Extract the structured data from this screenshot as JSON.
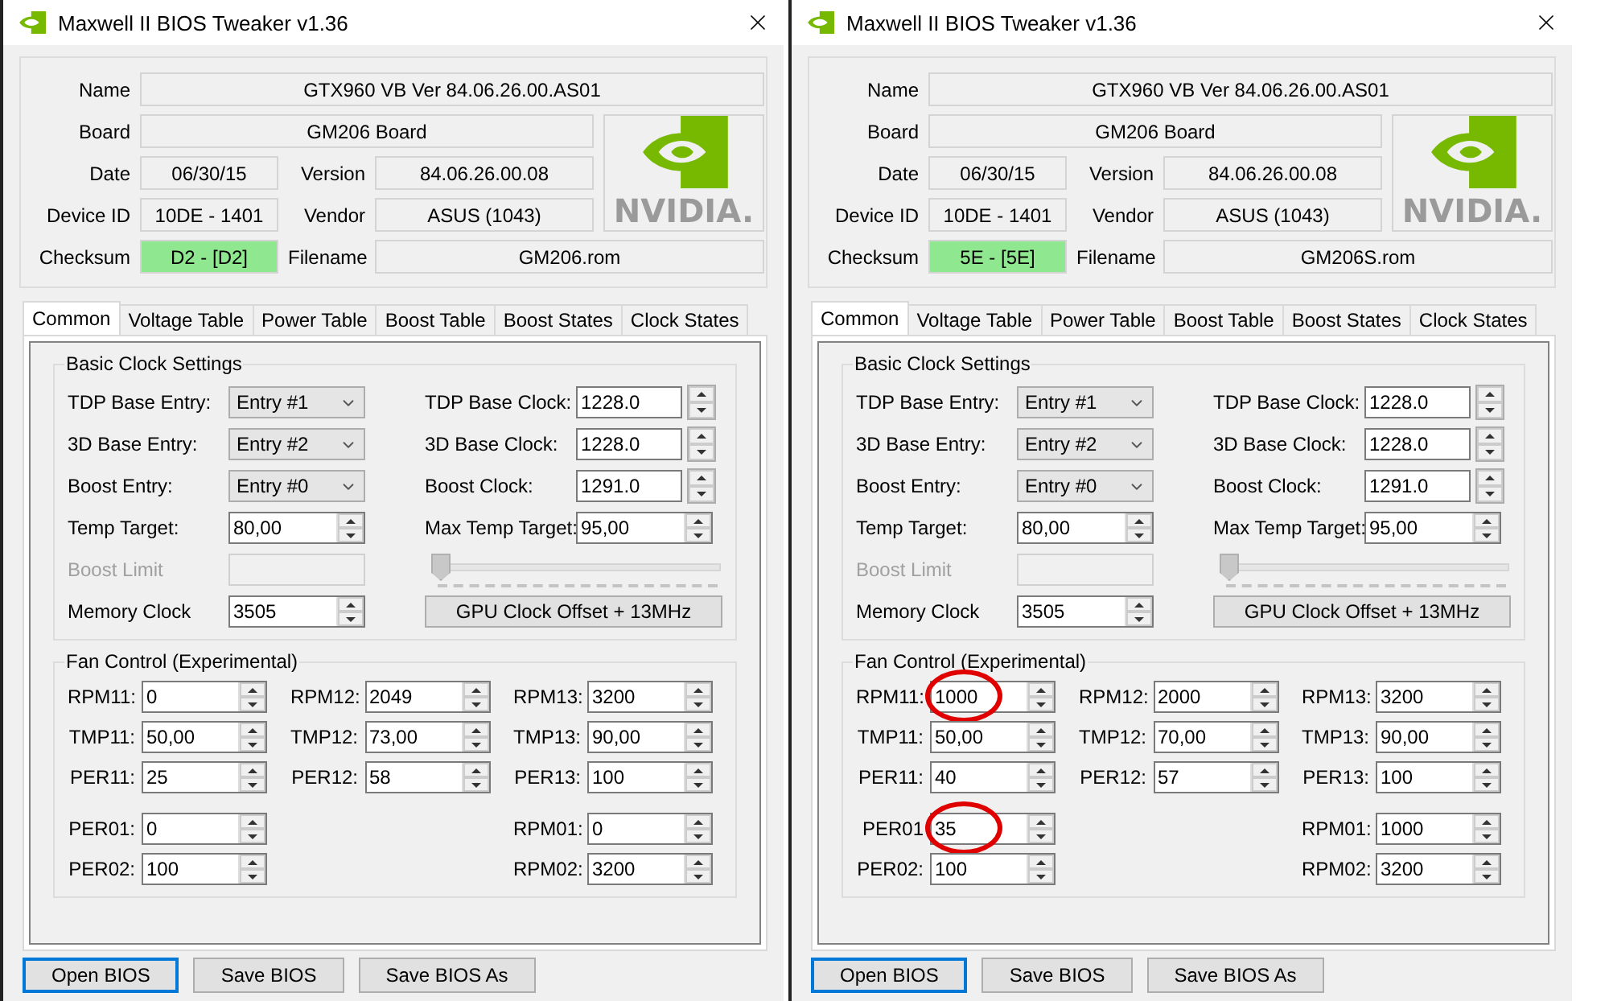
{
  "windows": [
    {
      "title": "Maxwell II BIOS Tweaker v1.36",
      "logo_text": "NVIDIA.",
      "info": [
        {
          "label": "Name",
          "value": "GTX960 VB Ver 84.06.26.00.AS01",
          "highlight": false
        },
        {
          "label": "Board",
          "value": "GM206 Board",
          "highlight": false
        },
        {
          "label": "Date",
          "value": "06/30/15",
          "highlight": false
        },
        {
          "label": "Version",
          "value": "84.06.26.00.08",
          "highlight": false
        },
        {
          "label": "Device ID",
          "value": "10DE - 1401",
          "highlight": false
        },
        {
          "label": "Vendor",
          "value": "ASUS (1043)",
          "highlight": false
        },
        {
          "label": "Checksum",
          "value": "D2 - [D2]",
          "highlight": true
        },
        {
          "label": "Filename",
          "value": "GM206.rom",
          "highlight": false
        }
      ],
      "tabs": [
        {
          "label": "Common",
          "selected": true
        },
        {
          "label": "Voltage Table",
          "selected": false
        },
        {
          "label": "Power Table",
          "selected": false
        },
        {
          "label": "Boost Table",
          "selected": false
        },
        {
          "label": "Boost States",
          "selected": false
        },
        {
          "label": "Clock States",
          "selected": false
        }
      ],
      "basic": {
        "title": "Basic Clock Settings",
        "left": [
          {
            "kind": "select",
            "label": "TDP Base Entry:",
            "value": "Entry #1"
          },
          {
            "kind": "select",
            "label": "3D Base Entry:",
            "value": "Entry #2"
          },
          {
            "kind": "select",
            "label": "Boost Entry:",
            "value": "Entry #0"
          },
          {
            "kind": "spin",
            "label": "Temp Target:",
            "value": "80,00"
          },
          {
            "kind": "disabled",
            "label": "Boost Limit"
          },
          {
            "kind": "spin",
            "label": "Memory Clock",
            "value": "3505"
          }
        ],
        "right": [
          {
            "kind": "clock",
            "label": "TDP Base Clock:",
            "value": "1228.0"
          },
          {
            "kind": "clock",
            "label": "3D Base Clock:",
            "value": "1228.0"
          },
          {
            "kind": "clock",
            "label": "Boost Clock:",
            "value": "1291.0"
          },
          {
            "kind": "spin",
            "label": "Max Temp Target:",
            "value": "95,00"
          },
          {
            "kind": "slider",
            "level": 0
          },
          {
            "kind": "button",
            "label": "GPU Clock Offset + 13MHz"
          }
        ]
      },
      "fan": {
        "title": "Fan Control (Experimental)",
        "grid": [
          [
            {
              "label": "RPM11:",
              "value": "0",
              "circled": false
            },
            {
              "label": "TMP11:",
              "value": "50,00",
              "circled": false
            },
            {
              "label": "PER11:",
              "value": "25",
              "circled": false
            }
          ],
          [
            {
              "label": "RPM12:",
              "value": "2049",
              "circled": false
            },
            {
              "label": "TMP12:",
              "value": "73,00",
              "circled": false
            },
            {
              "label": "PER12:",
              "value": "58",
              "circled": false
            }
          ],
          [
            {
              "label": "RPM13:",
              "value": "3200",
              "circled": false
            },
            {
              "label": "TMP13:",
              "value": "90,00",
              "circled": false
            },
            {
              "label": "PER13:",
              "value": "100",
              "circled": false
            }
          ]
        ],
        "extra_left": [
          {
            "label": "PER01:",
            "value": "0",
            "circled": false
          },
          {
            "label": "PER02:",
            "value": "100",
            "circled": false
          }
        ],
        "extra_right": [
          {
            "label": "RPM01:",
            "value": "0",
            "circled": false
          },
          {
            "label": "RPM02:",
            "value": "3200",
            "circled": false
          }
        ]
      },
      "buttons": [
        {
          "label": "Open BIOS",
          "focused": true
        },
        {
          "label": "Save BIOS",
          "focused": false
        },
        {
          "label": "Save BIOS As",
          "focused": false
        }
      ]
    },
    {
      "title": "Maxwell II BIOS Tweaker v1.36",
      "logo_text": "NVIDIA.",
      "info": [
        {
          "label": "Name",
          "value": "GTX960 VB Ver 84.06.26.00.AS01",
          "highlight": false
        },
        {
          "label": "Board",
          "value": "GM206 Board",
          "highlight": false
        },
        {
          "label": "Date",
          "value": "06/30/15",
          "highlight": false
        },
        {
          "label": "Version",
          "value": "84.06.26.00.08",
          "highlight": false
        },
        {
          "label": "Device ID",
          "value": "10DE - 1401",
          "highlight": false
        },
        {
          "label": "Vendor",
          "value": "ASUS (1043)",
          "highlight": false
        },
        {
          "label": "Checksum",
          "value": "5E - [5E]",
          "highlight": true
        },
        {
          "label": "Filename",
          "value": "GM206S.rom",
          "highlight": false
        }
      ],
      "tabs": [
        {
          "label": "Common",
          "selected": true
        },
        {
          "label": "Voltage Table",
          "selected": false
        },
        {
          "label": "Power Table",
          "selected": false
        },
        {
          "label": "Boost Table",
          "selected": false
        },
        {
          "label": "Boost States",
          "selected": false
        },
        {
          "label": "Clock States",
          "selected": false
        }
      ],
      "basic": {
        "title": "Basic Clock Settings",
        "left": [
          {
            "kind": "select",
            "label": "TDP Base Entry:",
            "value": "Entry #1"
          },
          {
            "kind": "select",
            "label": "3D Base Entry:",
            "value": "Entry #2"
          },
          {
            "kind": "select",
            "label": "Boost Entry:",
            "value": "Entry #0"
          },
          {
            "kind": "spin",
            "label": "Temp Target:",
            "value": "80,00"
          },
          {
            "kind": "disabled",
            "label": "Boost Limit"
          },
          {
            "kind": "spin",
            "label": "Memory Clock",
            "value": "3505"
          }
        ],
        "right": [
          {
            "kind": "clock",
            "label": "TDP Base Clock:",
            "value": "1228.0"
          },
          {
            "kind": "clock",
            "label": "3D Base Clock:",
            "value": "1228.0"
          },
          {
            "kind": "clock",
            "label": "Boost Clock:",
            "value": "1291.0"
          },
          {
            "kind": "spin",
            "label": "Max Temp Target:",
            "value": "95,00"
          },
          {
            "kind": "slider",
            "level": 0
          },
          {
            "kind": "button",
            "label": "GPU Clock Offset + 13MHz"
          }
        ]
      },
      "fan": {
        "title": "Fan Control (Experimental)",
        "grid": [
          [
            {
              "label": "RPM11:",
              "value": "1000",
              "circled": true
            },
            {
              "label": "TMP11:",
              "value": "50,00",
              "circled": false
            },
            {
              "label": "PER11:",
              "value": "40",
              "circled": false
            }
          ],
          [
            {
              "label": "RPM12:",
              "value": "2000",
              "circled": false
            },
            {
              "label": "TMP12:",
              "value": "70,00",
              "circled": false
            },
            {
              "label": "PER12:",
              "value": "57",
              "circled": false
            }
          ],
          [
            {
              "label": "RPM13:",
              "value": "3200",
              "circled": false
            },
            {
              "label": "TMP13:",
              "value": "90,00",
              "circled": false
            },
            {
              "label": "PER13:",
              "value": "100",
              "circled": false
            }
          ]
        ],
        "extra_left": [
          {
            "label": "PER01",
            "value": "35",
            "circled": true
          },
          {
            "label": "PER02:",
            "value": "100",
            "circled": false
          }
        ],
        "extra_right": [
          {
            "label": "RPM01:",
            "value": "1000",
            "circled": false
          },
          {
            "label": "RPM02:",
            "value": "3200",
            "circled": false
          }
        ]
      },
      "buttons": [
        {
          "label": "Open BIOS",
          "focused": true
        },
        {
          "label": "Save BIOS",
          "focused": false
        },
        {
          "label": "Save BIOS As",
          "focused": false
        }
      ]
    }
  ]
}
